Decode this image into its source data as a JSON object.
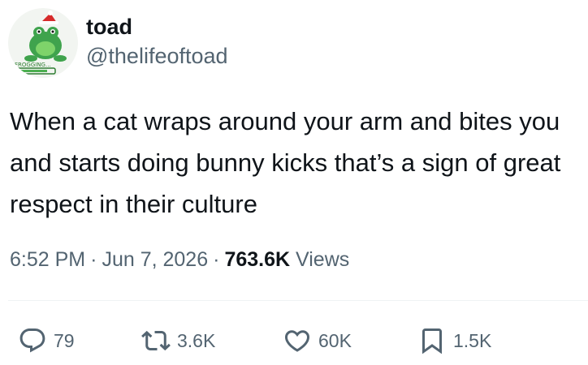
{
  "author": {
    "display_name": "toad",
    "handle": "@thelifeoftoad",
    "avatar_caption": "FROGGING..."
  },
  "tweet": {
    "text": "When a cat wraps around your arm and bites you and starts doing bunny kicks that’s a sign of great respect in their culture",
    "time": "6:52 PM",
    "separator": "·",
    "date": "Jun 7, 2026",
    "views_count": "763.6K",
    "views_label": "Views"
  },
  "actions": {
    "replies": "79",
    "reposts": "3.6K",
    "likes": "60K",
    "bookmarks": "1.5K"
  },
  "colors": {
    "text": "#0f1419",
    "secondary": "#536471",
    "divider": "#eff3f4",
    "frog_green": "#4caf50"
  },
  "icons": [
    "reply-icon",
    "repost-icon",
    "like-icon",
    "bookmark-icon"
  ]
}
